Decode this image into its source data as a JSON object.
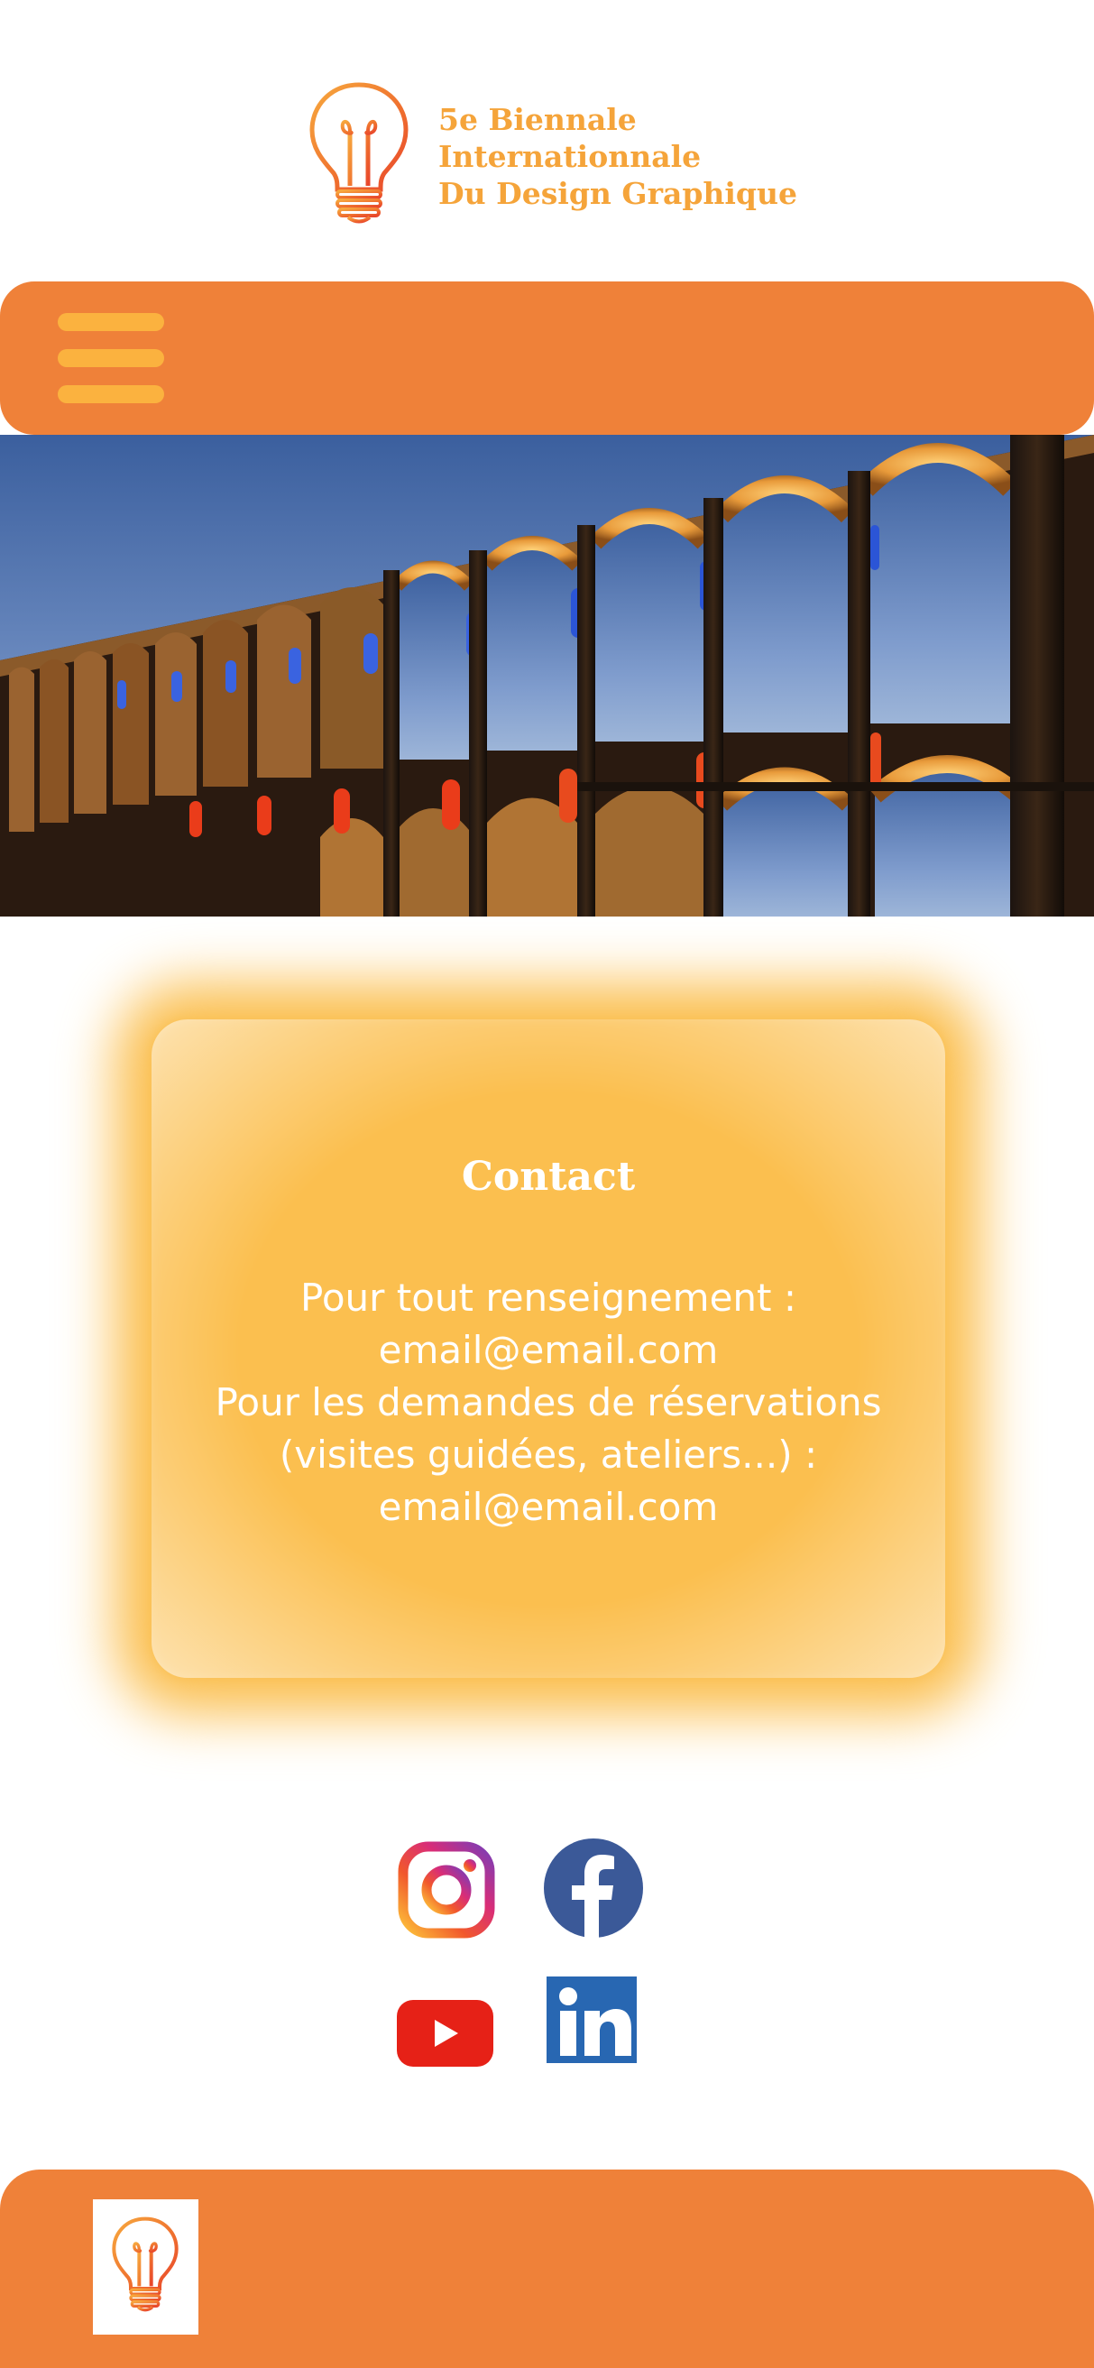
{
  "brand": {
    "line1": "5e Biennale",
    "line2": "Internationnale",
    "line3": "Du Design Graphique",
    "logo_icon": "lightbulb-icon"
  },
  "nav": {
    "menu_icon": "hamburger-menu-icon"
  },
  "hero": {
    "subject": "illuminated aqueduct arches at dusk"
  },
  "contact": {
    "title": "Contact",
    "line1": "Pour tout renseignement :",
    "email1": "email@email.com",
    "line2": "Pour les demandes de réservations",
    "line3": "(visites guidées, ateliers...) :",
    "email2": "email@email.com"
  },
  "social": [
    "instagram-icon",
    "facebook-icon",
    "youtube-icon",
    "linkedin-icon"
  ],
  "footer": {
    "logo_icon": "lightbulb-icon"
  },
  "colors": {
    "nav_orange": "#ef8139",
    "menu_bar": "#fbb23f",
    "brand_text": "#f5a43a",
    "contact_panel": "#fbbf4f",
    "facebook": "#3b5998",
    "youtube": "#e62117",
    "linkedin": "#2867b2"
  }
}
